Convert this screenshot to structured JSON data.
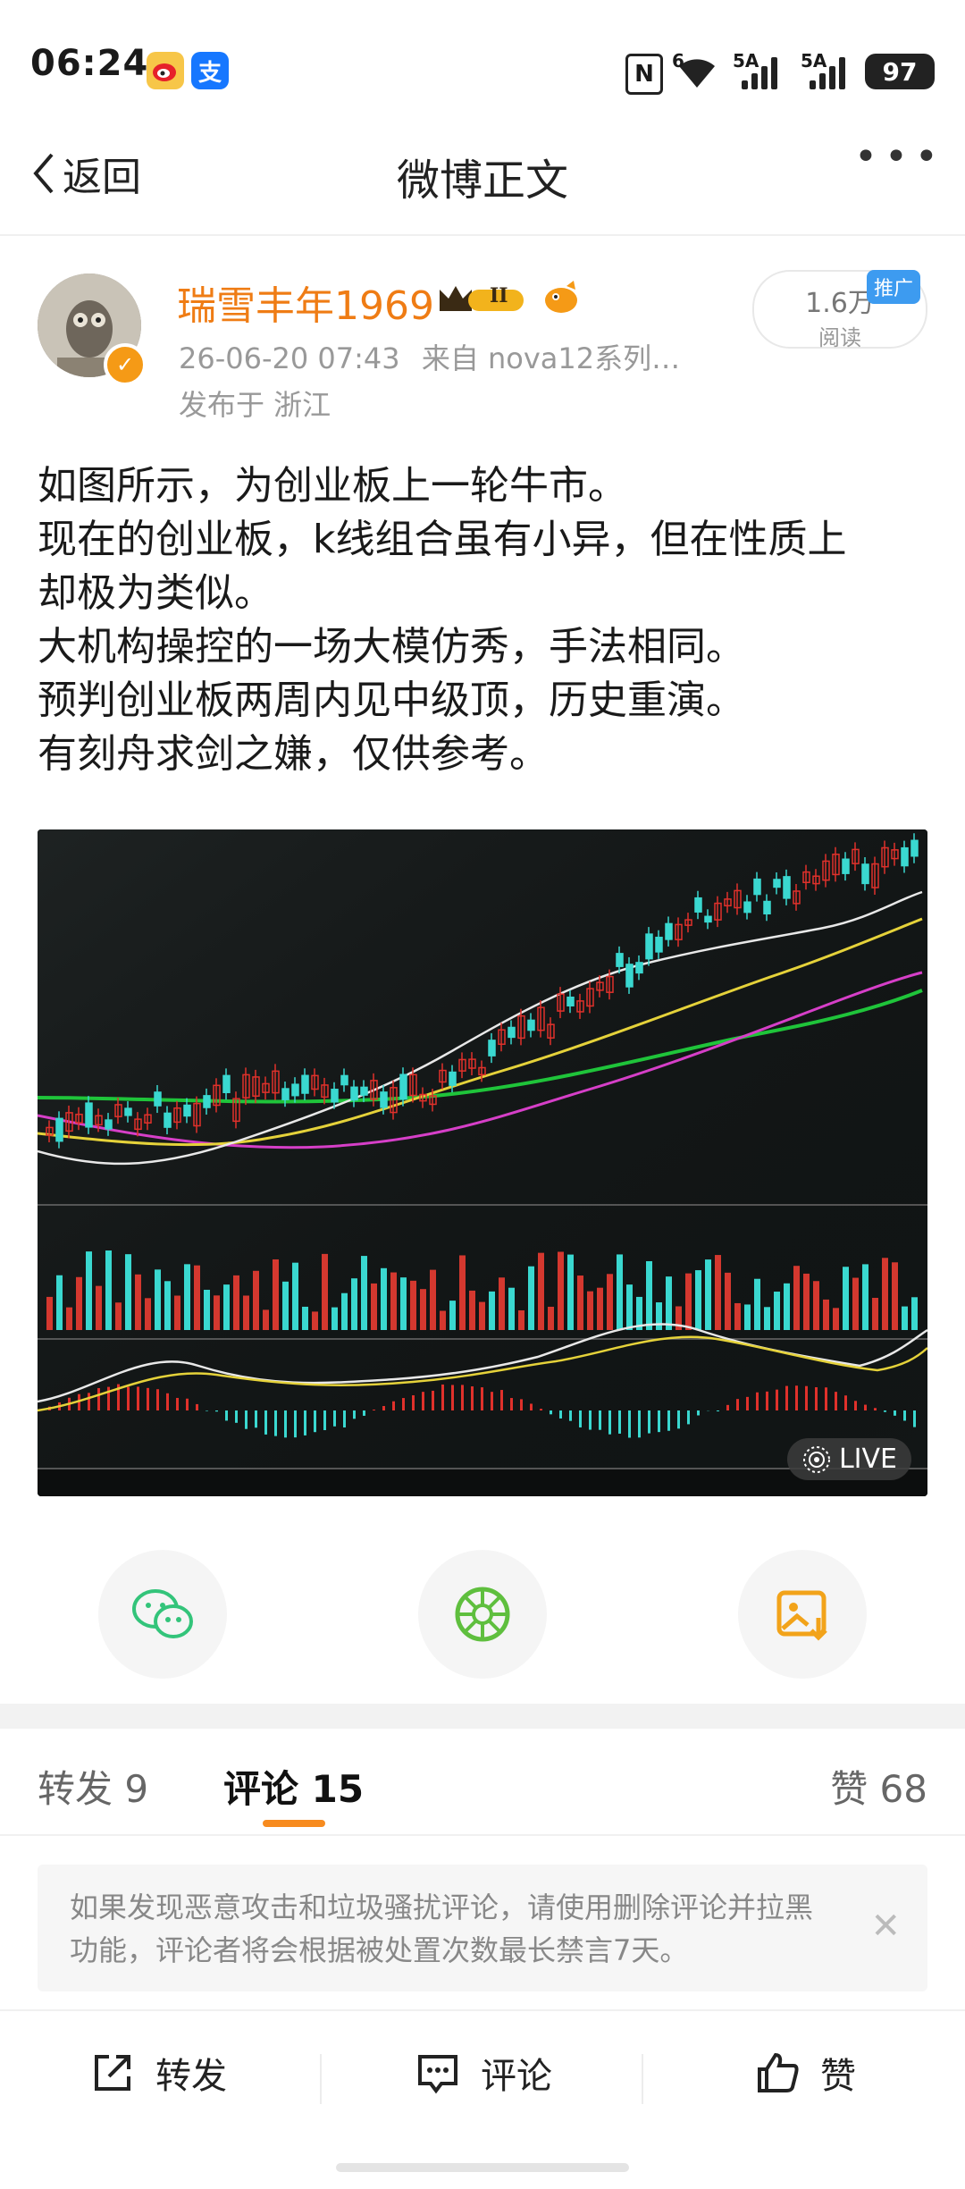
{
  "status_bar": {
    "time": "06:24",
    "alipay_icon_text": "支",
    "network_1": "5A",
    "network_2": "5A",
    "wifi_label": "6",
    "battery": "97"
  },
  "nav": {
    "back_label": "返回",
    "title": "微博正文",
    "more_label": "•••"
  },
  "post": {
    "author": "瑞雪丰年1969",
    "vip_level": "II",
    "timestamp": "26-06-20 07:43",
    "source": "来自 nova12系列…",
    "location": "发布于 浙江",
    "read_count": "1.6万",
    "read_label": "阅读",
    "promo_tag": "推广",
    "text_lines": [
      "如图所示，为创业板上一轮牛市。",
      "现在的创业板，k线组合虽有小异，但在性质上",
      "却极为类似。",
      "大机构操控的一场大模仿秀，手法相同。",
      "预判创业板两周内见中级顶，历史重演。",
      "有刻舟求剑之嫌，仅供参考。"
    ],
    "image_badge": "LIVE"
  },
  "tabs": {
    "repost": "转发 9",
    "comment": "评论 15",
    "like": "赞 68"
  },
  "notice": "如果发现恶意攻击和垃圾骚扰评论，请使用删除评论并拉黑功能，评论者将会根据被处置次数最长禁言7天。",
  "bottom_bar": {
    "repost": "转发",
    "comment": "评论",
    "like": "赞"
  },
  "colors": {
    "accent_orange": "#f78b1f",
    "author_orange": "#ef7c14",
    "wechat_green": "#33c47a"
  }
}
